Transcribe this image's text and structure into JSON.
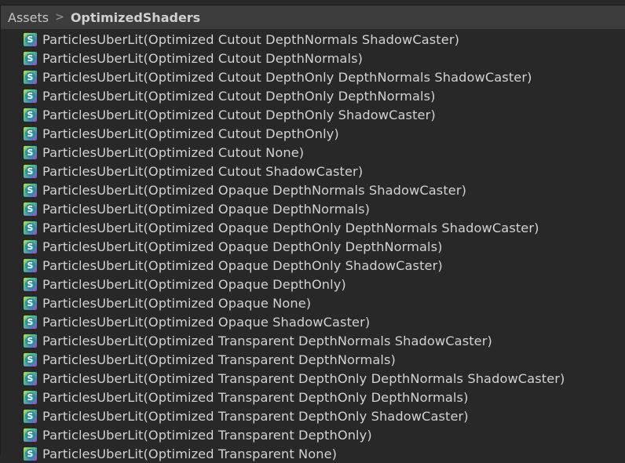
{
  "breadcrumb": {
    "root": "Assets",
    "separator": ">",
    "current": "OptimizedShaders"
  },
  "icon": {
    "name": "shader-icon",
    "glyph": "S"
  },
  "items": [
    "ParticlesUberLit(Optimized Cutout DepthNormals ShadowCaster)",
    "ParticlesUberLit(Optimized Cutout DepthNormals)",
    "ParticlesUberLit(Optimized Cutout DepthOnly DepthNormals ShadowCaster)",
    "ParticlesUberLit(Optimized Cutout DepthOnly DepthNormals)",
    "ParticlesUberLit(Optimized Cutout DepthOnly ShadowCaster)",
    "ParticlesUberLit(Optimized Cutout DepthOnly)",
    "ParticlesUberLit(Optimized Cutout None)",
    "ParticlesUberLit(Optimized Cutout ShadowCaster)",
    "ParticlesUberLit(Optimized Opaque DepthNormals ShadowCaster)",
    "ParticlesUberLit(Optimized Opaque DepthNormals)",
    "ParticlesUberLit(Optimized Opaque DepthOnly DepthNormals ShadowCaster)",
    "ParticlesUberLit(Optimized Opaque DepthOnly DepthNormals)",
    "ParticlesUberLit(Optimized Opaque DepthOnly ShadowCaster)",
    "ParticlesUberLit(Optimized Opaque DepthOnly)",
    "ParticlesUberLit(Optimized Opaque None)",
    "ParticlesUberLit(Optimized Opaque ShadowCaster)",
    "ParticlesUberLit(Optimized Transparent DepthNormals ShadowCaster)",
    "ParticlesUberLit(Optimized Transparent DepthNormals)",
    "ParticlesUberLit(Optimized Transparent DepthOnly DepthNormals ShadowCaster)",
    "ParticlesUberLit(Optimized Transparent DepthOnly DepthNormals)",
    "ParticlesUberLit(Optimized Transparent DepthOnly ShadowCaster)",
    "ParticlesUberLit(Optimized Transparent DepthOnly)",
    "ParticlesUberLit(Optimized Transparent None)"
  ]
}
